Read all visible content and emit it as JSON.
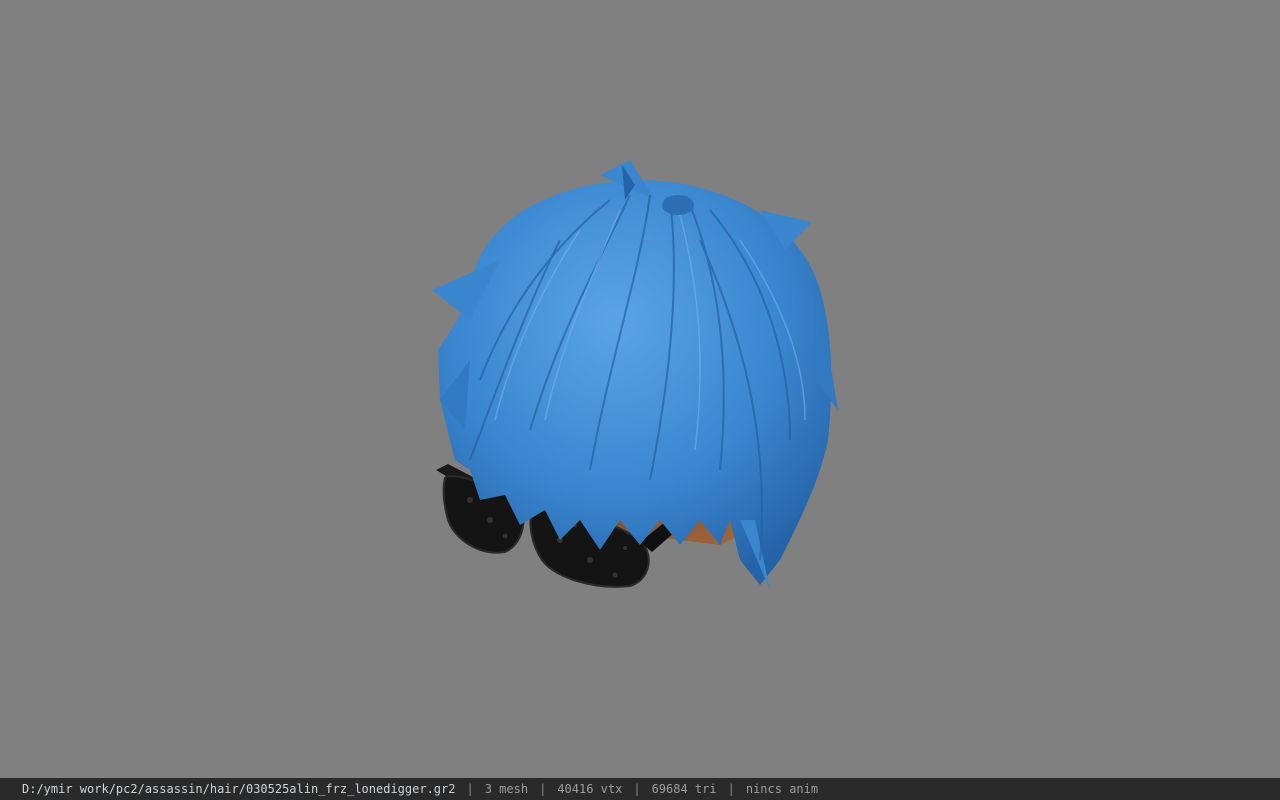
{
  "viewport": {
    "background": "#808080",
    "model": "blue spiky hair with black patterned sunglasses",
    "hair_color": "#3a86cf",
    "skin_color": "#8b5a36",
    "glasses_color": "#141414"
  },
  "status": {
    "path": "D:/ymir work/pc2/assassin/hair/030525alin_frz_lonedigger.gr2",
    "separator": "|",
    "mesh": "3 mesh",
    "vtx": "40416 vtx",
    "tri": "69684 tri",
    "anim": "nincs anim"
  }
}
